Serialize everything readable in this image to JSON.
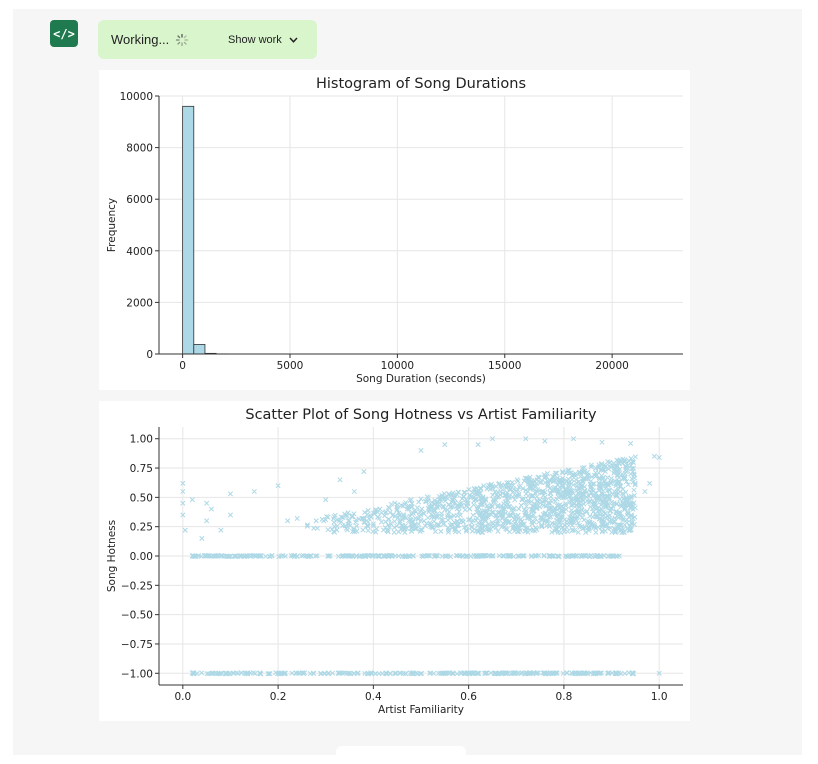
{
  "toolbar": {
    "code_icon": "code-icon",
    "status_text": "Working...",
    "show_work_label": "Show work",
    "accent": "#1f7a4f",
    "status_bg": "#d9f5cc"
  },
  "chart_data": [
    {
      "type": "bar",
      "title": "Histogram of Song Durations",
      "xlabel": "Song Duration (seconds)",
      "ylabel": "Frequency",
      "xlim": [
        -1100,
        23300
      ],
      "ylim": [
        0,
        10000
      ],
      "xticks": [
        0,
        5000,
        10000,
        15000,
        20000
      ],
      "yticks": [
        0,
        2000,
        4000,
        6000,
        8000,
        10000
      ],
      "grid": true,
      "bar_color": "#add8e6",
      "bins": [
        {
          "x0": 0,
          "x1": 520,
          "value": 9600
        },
        {
          "x0": 520,
          "x1": 1040,
          "value": 370
        },
        {
          "x0": 1040,
          "x1": 1560,
          "value": 25
        },
        {
          "x0": 1560,
          "x1": 2080,
          "value": 5
        }
      ]
    },
    {
      "type": "scatter",
      "title": "Scatter Plot of Song Hotness vs Artist Familiarity",
      "xlabel": "Artist Familiarity",
      "ylabel": "Song Hotness",
      "xlim": [
        -0.05,
        1.05
      ],
      "ylim": [
        -1.1,
        1.1
      ],
      "xticks": [
        0.0,
        0.2,
        0.4,
        0.6,
        0.8,
        1.0
      ],
      "xtick_labels": [
        "0.0",
        "0.2",
        "0.4",
        "0.6",
        "0.8",
        "1.0"
      ],
      "yticks": [
        1.0,
        0.75,
        0.5,
        0.25,
        0.0,
        -0.25,
        -0.5,
        -0.75,
        -1.0
      ],
      "ytick_labels": [
        "1.00",
        "0.75",
        "0.50",
        "0.25",
        "0.00",
        "−0.25",
        "−0.50",
        "−0.75",
        "−1.00"
      ],
      "grid": true,
      "marker": "x",
      "color": "#add8e6",
      "bands": [
        {
          "y": -1.0,
          "x_range": [
            0.02,
            0.95
          ]
        },
        {
          "y": 0.0,
          "x_range": [
            0.02,
            0.92
          ]
        }
      ],
      "cloud": {
        "x_range": [
          0.25,
          0.95
        ],
        "y_range": [
          0.2,
          0.85
        ]
      },
      "points": [
        [
          0.0,
          0.62
        ],
        [
          0.0,
          0.55
        ],
        [
          0.0,
          0.45
        ],
        [
          0.0,
          0.35
        ],
        [
          0.005,
          0.22
        ],
        [
          0.02,
          0.48
        ],
        [
          0.04,
          0.15
        ],
        [
          0.05,
          0.45
        ],
        [
          0.06,
          0.4
        ],
        [
          0.05,
          0.3
        ],
        [
          0.08,
          0.22
        ],
        [
          0.1,
          0.35
        ],
        [
          0.1,
          0.53
        ],
        [
          0.15,
          0.55
        ],
        [
          0.2,
          0.6
        ],
        [
          0.22,
          0.3
        ],
        [
          0.24,
          0.32
        ],
        [
          0.28,
          0.3
        ],
        [
          0.3,
          0.48
        ],
        [
          0.33,
          0.65
        ],
        [
          0.36,
          0.55
        ],
        [
          0.38,
          0.72
        ],
        [
          0.5,
          0.9
        ],
        [
          0.55,
          0.95
        ],
        [
          0.65,
          1.0
        ],
        [
          0.62,
          0.95
        ],
        [
          0.72,
          1.0
        ],
        [
          0.76,
          0.98
        ],
        [
          0.82,
          1.0
        ],
        [
          0.88,
          0.97
        ],
        [
          0.94,
          0.96
        ],
        [
          0.97,
          0.55
        ],
        [
          0.98,
          0.62
        ],
        [
          0.99,
          0.85
        ],
        [
          1.0,
          0.84
        ],
        [
          1.0,
          -1.0
        ],
        [
          0.91,
          0.0
        ]
      ]
    }
  ]
}
